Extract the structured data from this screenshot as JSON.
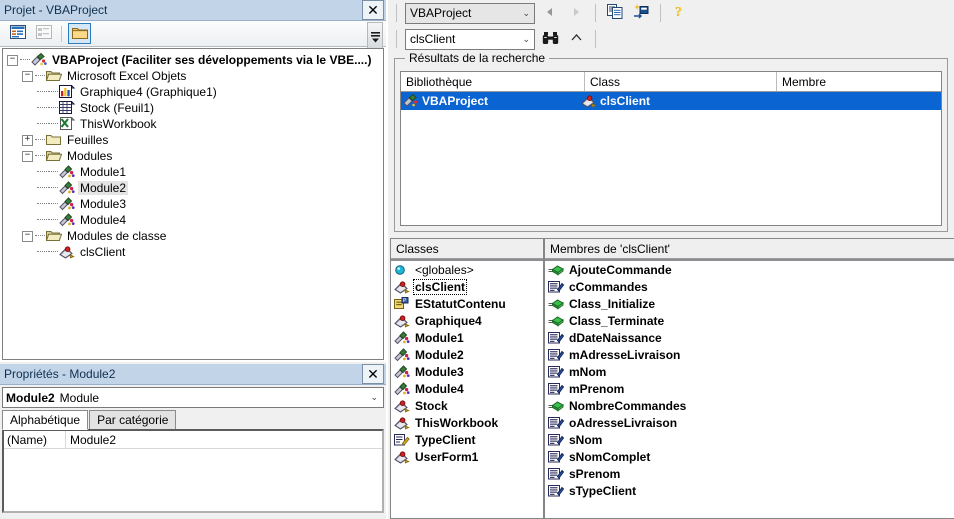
{
  "project_window": {
    "title": "Projet - VBAProject",
    "close_label": "✕",
    "toolbar": {
      "view_code_icon": "view-code-icon",
      "view_object_icon": "view-object-icon",
      "toggle_folders_icon": "folder-icon",
      "overflow_icon": "toolbar-overflow-icon"
    },
    "tree": [
      {
        "label": "VBAProject (Faciliter ses développements via le VBE....)",
        "depth": 0,
        "expander": "−",
        "icon": "vba-project-icon",
        "bold": true,
        "highlight": false
      },
      {
        "label": "Microsoft Excel Objets",
        "depth": 1,
        "expander": "−",
        "icon": "folder-open-icon",
        "bold": false,
        "highlight": false
      },
      {
        "label": "Graphique4 (Graphique1)",
        "depth": 2,
        "expander": "",
        "icon": "chart-sheet-icon",
        "bold": false,
        "highlight": false
      },
      {
        "label": "Stock (Feuil1)",
        "depth": 2,
        "expander": "",
        "icon": "worksheet-icon",
        "bold": false,
        "highlight": false
      },
      {
        "label": "ThisWorkbook",
        "depth": 2,
        "expander": "",
        "icon": "workbook-icon",
        "bold": false,
        "highlight": false
      },
      {
        "label": "Feuilles",
        "depth": 1,
        "expander": "+",
        "icon": "folder-closed-icon",
        "bold": false,
        "highlight": false
      },
      {
        "label": "Modules",
        "depth": 1,
        "expander": "−",
        "icon": "folder-open-icon",
        "bold": false,
        "highlight": false
      },
      {
        "label": "Module1",
        "depth": 2,
        "expander": "",
        "icon": "module-icon",
        "bold": false,
        "highlight": false
      },
      {
        "label": "Module2",
        "depth": 2,
        "expander": "",
        "icon": "module-icon",
        "bold": false,
        "highlight": true
      },
      {
        "label": "Module3",
        "depth": 2,
        "expander": "",
        "icon": "module-icon",
        "bold": false,
        "highlight": false
      },
      {
        "label": "Module4",
        "depth": 2,
        "expander": "",
        "icon": "module-icon",
        "bold": false,
        "highlight": false
      },
      {
        "label": "Modules de classe",
        "depth": 1,
        "expander": "−",
        "icon": "folder-open-icon",
        "bold": false,
        "highlight": false
      },
      {
        "label": "clsClient",
        "depth": 2,
        "expander": "",
        "icon": "class-module-icon",
        "bold": false,
        "highlight": false
      }
    ]
  },
  "properties_window": {
    "title": "Propriétés - Module2",
    "close_label": "✕",
    "object_name": "Module2",
    "object_type": "Module",
    "dropdown_arrow": "⌄",
    "tabs": [
      {
        "label": "Alphabétique",
        "active": true
      },
      {
        "label": "Par catégorie",
        "active": false
      }
    ],
    "rows": [
      {
        "key": "(Name)",
        "value": "Module2"
      }
    ]
  },
  "object_browser": {
    "project_combo": {
      "value": "VBAProject",
      "arrow": "⌄"
    },
    "search_combo": {
      "value": "clsClient",
      "placeholder": "",
      "arrow": "⌄"
    },
    "toolbar": {
      "back_icon": "back-arrow-icon",
      "forward_icon": "forward-arrow-icon",
      "copy_icon": "copy-to-clipboard-icon",
      "view_definition_icon": "view-definition-icon",
      "help_icon": "help-icon",
      "search_icon": "binoculars-search-icon",
      "toggle_results_icon": "chevron-up-icon"
    },
    "search_results": {
      "legend": "Résultats de la recherche",
      "columns": [
        "Bibliothèque",
        "Class",
        "Membre"
      ],
      "rows": [
        {
          "library": "VBAProject",
          "library_icon": "vba-project-icon",
          "klass": "clsClient",
          "class_icon": "class-module-icon",
          "member": "",
          "selected": true
        }
      ]
    },
    "classes_pane": {
      "header": "Classes",
      "items": [
        {
          "label": "<globales>",
          "icon": "globals-icon",
          "bold": false,
          "focused": false
        },
        {
          "label": "clsClient",
          "icon": "class-module-icon",
          "bold": true,
          "focused": true
        },
        {
          "label": "EStatutContenu",
          "icon": "enum-icon",
          "bold": true,
          "focused": false
        },
        {
          "label": "Graphique4",
          "icon": "class-module-icon",
          "bold": true,
          "focused": false
        },
        {
          "label": "Module1",
          "icon": "module-icon",
          "bold": true,
          "focused": false
        },
        {
          "label": "Module2",
          "icon": "module-icon",
          "bold": true,
          "focused": false
        },
        {
          "label": "Module3",
          "icon": "module-icon",
          "bold": true,
          "focused": false
        },
        {
          "label": "Module4",
          "icon": "module-icon",
          "bold": true,
          "focused": false
        },
        {
          "label": "Stock",
          "icon": "class-module-icon",
          "bold": true,
          "focused": false
        },
        {
          "label": "ThisWorkbook",
          "icon": "class-module-icon",
          "bold": true,
          "focused": false
        },
        {
          "label": "TypeClient",
          "icon": "udt-icon",
          "bold": true,
          "focused": false
        },
        {
          "label": "UserForm1",
          "icon": "class-module-icon",
          "bold": true,
          "focused": false
        }
      ]
    },
    "members_pane": {
      "header": "Membres de 'clsClient'",
      "items": [
        {
          "label": "AjouteCommande",
          "icon": "method-icon"
        },
        {
          "label": "cCommandes",
          "icon": "property-icon"
        },
        {
          "label": "Class_Initialize",
          "icon": "method-icon"
        },
        {
          "label": "Class_Terminate",
          "icon": "method-icon"
        },
        {
          "label": "dDateNaissance",
          "icon": "property-icon"
        },
        {
          "label": "mAdresseLivraison",
          "icon": "property-icon"
        },
        {
          "label": "mNom",
          "icon": "property-icon"
        },
        {
          "label": "mPrenom",
          "icon": "property-icon"
        },
        {
          "label": "NombreCommandes",
          "icon": "method-icon"
        },
        {
          "label": "oAdresseLivraison",
          "icon": "property-icon"
        },
        {
          "label": "sNom",
          "icon": "property-icon"
        },
        {
          "label": "sNomComplet",
          "icon": "property-icon"
        },
        {
          "label": "sPrenom",
          "icon": "property-icon"
        },
        {
          "label": "sTypeClient",
          "icon": "property-icon"
        }
      ]
    }
  },
  "colors": {
    "titlebar": "#c2d4e8",
    "selection": "#0a64d2",
    "selection_text": "#ffffff",
    "panel_bg": "#f0f0f0",
    "list_bg": "#ffffff"
  }
}
